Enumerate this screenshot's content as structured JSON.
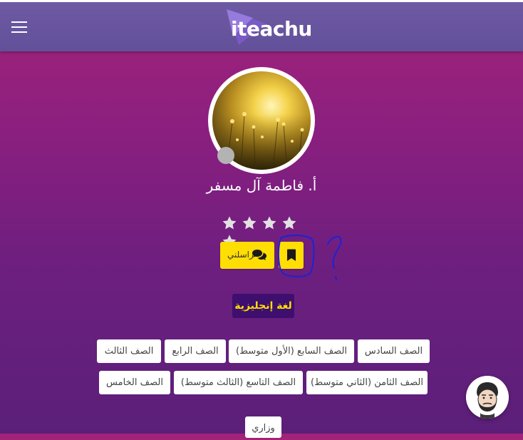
{
  "header": {
    "logo_text": "iteachu"
  },
  "profile": {
    "name": "أ. فاطمة آل مسفر",
    "rating": 5,
    "max_rating": 5
  },
  "actions": {
    "message_label": "راسلني"
  },
  "subject": "لغة إنجليزية",
  "grades": [
    "الصف السادس",
    "الصف السابع (الأول متوسط)",
    "الصف الرابع",
    "الصف الثالث",
    "الصف الثامن (الثاني متوسط)",
    "الصف التاسع (الثالث متوسط)",
    "الصف الخامس",
    "وزاري"
  ],
  "colors": {
    "accent_yellow": "#ffde03",
    "subject_bg": "#3e0f6e",
    "header": "#6a569f",
    "annotation": "#1a23d6"
  },
  "icons": {
    "menu": "hamburger-icon",
    "message": "comments-icon",
    "bookmark": "bookmark-icon",
    "chat": "chat-avatar-icon"
  }
}
